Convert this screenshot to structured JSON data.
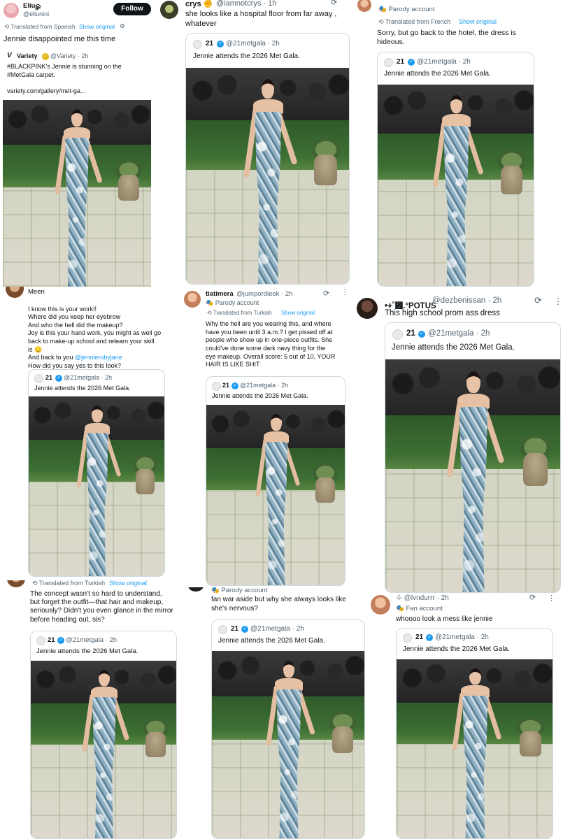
{
  "tiles": {
    "t1": {
      "name": "Eliuௐ",
      "handle": "@eliunini",
      "follow": "Follow",
      "translated": "Translated from Spanish",
      "show_original": "Show original",
      "text": "Jennie disappointed me this time",
      "quote": {
        "name": "Variety",
        "handle": "@Variety · 2h",
        "text_line1": "#BLACKPINK's Jennie is stunning on the",
        "text_line2": "#MetGala carpet.",
        "link": "variety.com/gallery/met-ga..."
      }
    },
    "t2": {
      "name": "crys",
      "emoji": "✊",
      "handle": "@iamnotcrys · 1h",
      "text": "she looks like a hospital floor from far away ,\nwhatever",
      "quote": {
        "name": "21",
        "handle": "@21metgala · 2h",
        "text": "Jennie attends the 2026 Met Gala."
      }
    },
    "t3": {
      "parody": "Parody account",
      "translated": "Translated from French",
      "show_original": "Show original",
      "text": "Sorry, but go back to the hotel, the dress is\nhideous.",
      "quote": {
        "name": "21",
        "handle": "@21metgala · 2h",
        "text": "Jennie attends the 2026 Met Gala."
      }
    },
    "t4": {
      "name": "Meen",
      "text": "I know this is your work!!\nWhere did you keep her eyebrow\nAnd who the hell did the makeup?\nJoy is this your hand work, you might as well go\nback to make-up school and relearn your skill\nis 😞\nAnd back to you @jennierubyjane\nHow did you say yes to this look?",
      "quote": {
        "name": "21",
        "handle": "@21metgala · 2h",
        "text": "Jennie attends the 2026 Met Gala."
      }
    },
    "t5": {
      "name": "tiatimera",
      "handle": "@jumpordieok · 2h",
      "parody": "Parody account",
      "translated": "Translated from Turkish",
      "show_original": "Show original",
      "text": "Why the hell are you wearing this, and where\nhave you been until 3 a.m.? I get pissed off at\npeople who show up in one-piece outfits. She\ncould've done some dark navy thing for the\neye makeup. Overall score: 5 out of 10, YOUR\nHAIR IS LIKE SHIT",
      "quote": {
        "name": "21",
        "handle": "@21metgala · 2h",
        "text": "Jennie attends the 2026 Met Gala."
      }
    },
    "t6": {
      "name": "•༓˚₟.°POTUS",
      "handle": "@dezbenissan · 2h",
      "text": "This high school prom ass dress",
      "quote": {
        "name": "21",
        "handle": "@21metgala · 2h",
        "text": "Jennie attends the 2026 Met Gala."
      }
    },
    "t7": {
      "translated": "Translated from Turkish",
      "show_original": "Show original",
      "text": "The concept wasn't so hard to understand,\nbut forget the outfit—that hair and makeup,\nseriously? Didn't you even glance in the mirror\nbefore heading out, sis?",
      "quote": {
        "name": "21",
        "handle": "@21metgala · 2h",
        "text": "Jennie attends the 2026 Met Gala."
      }
    },
    "t8": {
      "parody": "Parody account",
      "text": "fan war aside but why she always looks like\nshe's nervous?",
      "quote": {
        "name": "21",
        "handle": "@21metgala · 2h",
        "text": "Jennie attends the 2026 Met Gala."
      }
    },
    "t9": {
      "handle": "@lvndurrr · 2h",
      "fan": "Fan account",
      "text": "whoooo look a mess like jennie",
      "quote": {
        "name": "21",
        "handle": "@21metgala · 2h",
        "text": "Jennie attends the 2026 Met Gala."
      }
    }
  },
  "icons": {
    "grok": "grok-icon",
    "more": "more-icon",
    "parody_badge": "mask-icon",
    "translate": "translate-icon",
    "verified": "verified-badge-icon",
    "gear": "gear-icon"
  },
  "colors": {
    "link": "#1d9bf0",
    "muted": "#536471",
    "text": "#0f1419",
    "border": "#cfd9de"
  }
}
